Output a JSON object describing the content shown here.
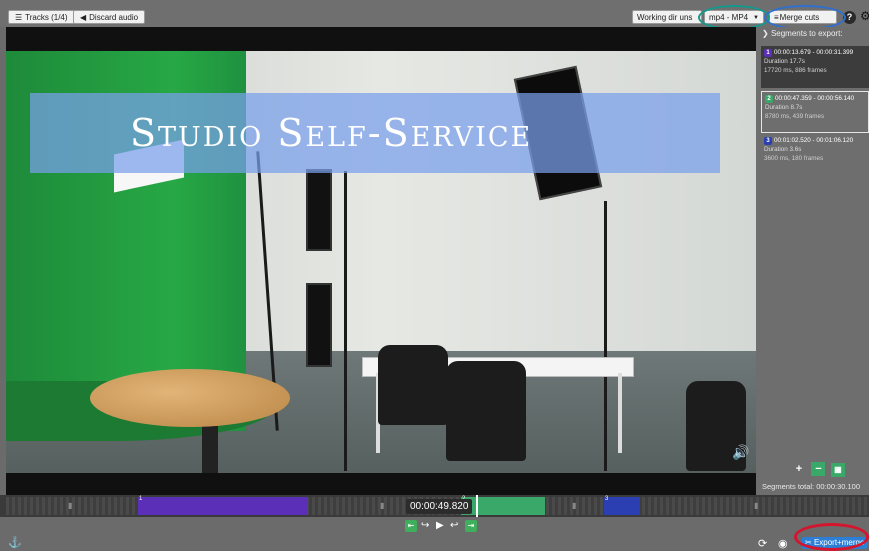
{
  "toolbar": {
    "tracks_label": "Tracks (1/4)",
    "discard_audio_label": "Discard audio",
    "working_dir_label": "Working dir uns",
    "format_label": "mp4 - MP4",
    "merge_label": "Merge cuts",
    "help_glyph": "?"
  },
  "video": {
    "banner_text": "Studio Self-Service"
  },
  "segments_panel": {
    "header": "Segments to export:",
    "segments": [
      {
        "number": "1",
        "range": "00:00:13.679 - 00:00:31.399",
        "duration": "Duration 17.7s",
        "detail": "17720 ms, 886 frames",
        "color": "#5b2fb8"
      },
      {
        "number": "2",
        "range": "00:00:47.359 - 00:00:56.140",
        "duration": "Duration 8.7s",
        "detail": "8780 ms, 439 frames",
        "color": "#3aa869"
      },
      {
        "number": "3",
        "range": "00:01:02.520 - 00:01:06.120",
        "duration": "Duration 3.6s",
        "detail": "3600 ms, 180 frames",
        "color": "#2b3fb3"
      }
    ],
    "total_label": "Segments total:",
    "total_value": "00:00:30.100"
  },
  "timeline": {
    "timecode": "00:00:49.820",
    "segment_labels": [
      "1",
      "2",
      "3"
    ]
  },
  "controls": {
    "export_label": "Export+merge"
  },
  "colors": {
    "accent_blue": "#2d7fd6",
    "seg1": "#5b2fb8",
    "seg2": "#3aa869",
    "seg3": "#2b3fb3",
    "annotation_teal": "#139a8c",
    "annotation_blue": "#2f6fd0",
    "annotation_red": "#d4152d"
  }
}
